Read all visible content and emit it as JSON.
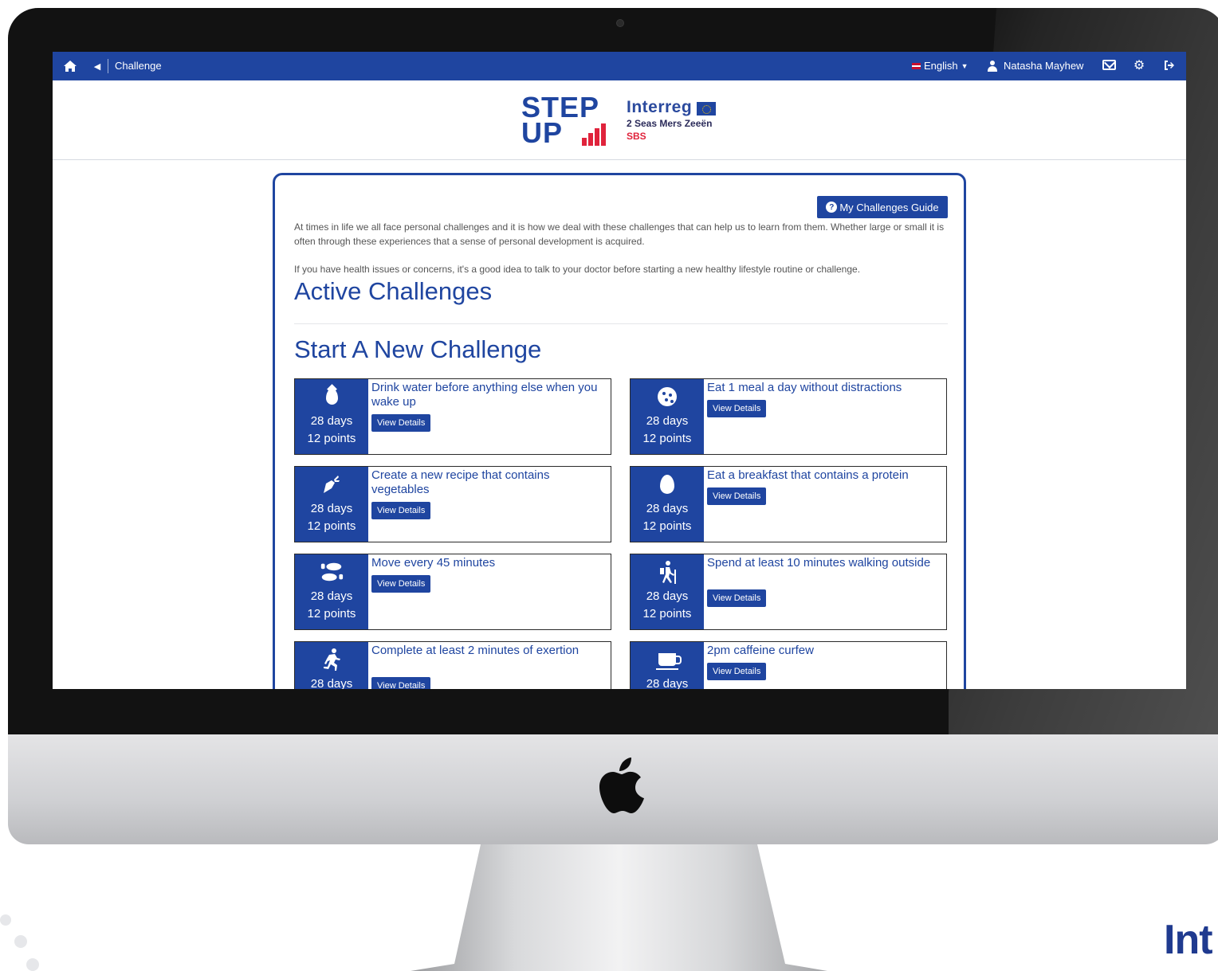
{
  "topbar": {
    "breadcrumb": "Challenge",
    "language": "English",
    "user_name": "Natasha Mayhew"
  },
  "branding": {
    "app_logo_line1": "STEP",
    "app_logo_line2": "UP",
    "interreg_name": "Interreg",
    "interreg_region": "2 Seas Mers Zeeën",
    "interreg_project": "SBS",
    "corner_brand": "Int"
  },
  "guide_button": "My Challenges Guide",
  "intro_text": "At times in life we all face personal challenges and it is how we deal with these challenges that can help us to learn from them. Whether large or small it is often through these experiences that a sense of personal development is acquired.",
  "disclaimer_text": "If you have health issues or concerns, it's a good idea to talk to your doctor before starting a new healthy lifestyle routine or challenge.",
  "active_heading": "Active Challenges",
  "start_heading": "Start A New Challenge",
  "challenges": [
    {
      "title": "Drink water before anything else when you wake up",
      "days": "28 days",
      "points": "12 points",
      "button": "View Details",
      "icon": "water-drop-icon"
    },
    {
      "title": "Eat 1 meal a day without distractions",
      "days": "28 days",
      "points": "12 points",
      "button": "View Details",
      "icon": "cookie-icon"
    },
    {
      "title": "Create a new recipe that contains vegetables",
      "days": "28 days",
      "points": "12 points",
      "button": "View Details",
      "icon": "carrot-icon"
    },
    {
      "title": "Eat a breakfast that contains a protein",
      "days": "28 days",
      "points": "12 points",
      "button": "View Details",
      "icon": "egg-icon"
    },
    {
      "title": "Move every 45 minutes",
      "days": "28 days",
      "points": "12 points",
      "button": "View Details",
      "icon": "shoe-prints-icon"
    },
    {
      "title": "Spend at least 10 minutes walking outside",
      "days": "28 days",
      "points": "12 points",
      "button": "View Details",
      "icon": "hiking-icon"
    },
    {
      "title": "Complete at least 2 minutes of exertion",
      "days": "28 days",
      "points": "",
      "button": "View Details",
      "icon": "running-icon"
    },
    {
      "title": "2pm caffeine curfew",
      "days": "28 days",
      "points": "",
      "button": "View Details",
      "icon": "coffee-cup-icon"
    }
  ],
  "colors": {
    "primary": "#1f45a0",
    "accent_red": "#e0233c",
    "bezel": "#121212"
  }
}
